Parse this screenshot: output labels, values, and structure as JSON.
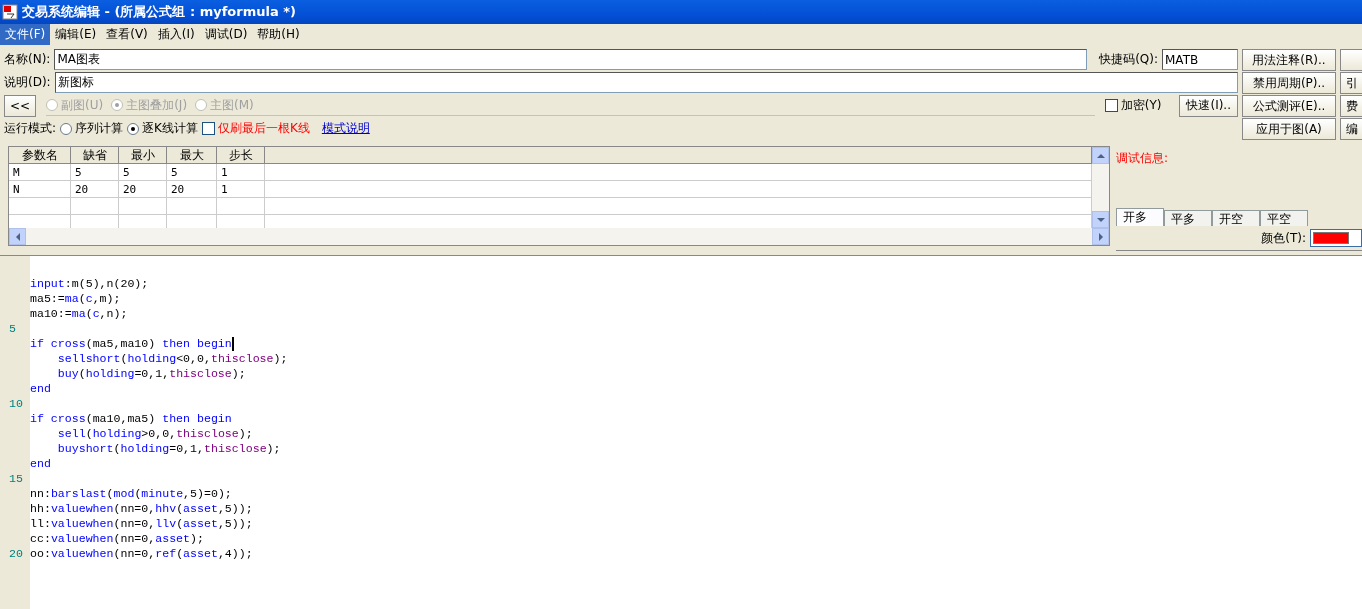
{
  "window": {
    "title": "交易系统编辑 - (所属公式组 : myformula *)"
  },
  "menu": [
    {
      "label": "文件(F)",
      "selected": true
    },
    {
      "label": "编辑(E)",
      "selected": false
    },
    {
      "label": "查看(V)",
      "selected": false
    },
    {
      "label": "插入(I)",
      "selected": false
    },
    {
      "label": "调试(D)",
      "selected": false
    },
    {
      "label": "帮助(H)",
      "selected": false
    }
  ],
  "name_field": {
    "label": "名称(N):",
    "value": "MA图表"
  },
  "shortcut_field": {
    "label": "快捷码(Q):",
    "value": "MATB"
  },
  "desc_field": {
    "label": "说明(D):",
    "value": "新图标"
  },
  "collapse_button": "<<",
  "chart_type": [
    {
      "label": "副图(U)",
      "selected": false,
      "disabled": true
    },
    {
      "label": "主图叠加(J)",
      "selected": true,
      "disabled": true
    },
    {
      "label": "主图(M)",
      "selected": false,
      "disabled": true
    }
  ],
  "encrypt": {
    "label": "加密(Y)",
    "checked": false
  },
  "quick_button": "快速(I)..",
  "run_mode": {
    "label": "运行模式:",
    "options": [
      {
        "label": "序列计算",
        "selected": false
      },
      {
        "label": "逐K线计算",
        "selected": true
      }
    ],
    "refresh_last": {
      "label": "仅刷最后一根K线",
      "checked": false
    },
    "link": "模式说明"
  },
  "buttons": [
    "用法注释(R)..",
    "禁用周期(P)..",
    "公式测评(E)..",
    "应用于图(A)"
  ],
  "cut_buttons": [
    "引",
    "费",
    "编"
  ],
  "table": {
    "columns": [
      "参数名",
      "缺省",
      "最小",
      "最大",
      "步长"
    ],
    "rows": [
      [
        "M",
        "5",
        "5",
        "5",
        "1"
      ],
      [
        "N",
        "20",
        "20",
        "20",
        "1"
      ],
      [
        "",
        "",
        "",
        "",
        ""
      ],
      [
        "",
        "",
        "",
        "",
        ""
      ]
    ]
  },
  "debug": {
    "label": "调试信息:"
  },
  "tabs": [
    {
      "label": "开多",
      "selected": true
    },
    {
      "label": "平多",
      "selected": false
    },
    {
      "label": "开空",
      "selected": false
    },
    {
      "label": "平空",
      "selected": false
    }
  ],
  "color_field": {
    "label": "颜色(T):",
    "color": "#ff0000"
  },
  "code": [
    {
      "tokens": [
        {
          "kind": "kw",
          "text": "input"
        },
        {
          "kind": "plain",
          "text": ":m(5),n(20);"
        }
      ]
    },
    {
      "tokens": [
        {
          "kind": "plain",
          "text": "ma5:="
        },
        {
          "kind": "kw",
          "text": "ma"
        },
        {
          "kind": "plain",
          "text": "("
        },
        {
          "kind": "kw",
          "text": "c"
        },
        {
          "kind": "plain",
          "text": ",m);"
        }
      ]
    },
    {
      "tokens": [
        {
          "kind": "plain",
          "text": "ma10:="
        },
        {
          "kind": "kw",
          "text": "ma"
        },
        {
          "kind": "plain",
          "text": "("
        },
        {
          "kind": "kw",
          "text": "c"
        },
        {
          "kind": "plain",
          "text": ",n);"
        }
      ]
    },
    {
      "number": "5"
    },
    {
      "tokens": [
        {
          "kind": "kw",
          "text": "if cross"
        },
        {
          "kind": "plain",
          "text": "(ma5,ma10) "
        },
        {
          "kind": "kw",
          "text": "then begin"
        }
      ],
      "cursor": true
    },
    {
      "indent": true,
      "tokens": [
        {
          "kind": "kw",
          "text": "sellshort"
        },
        {
          "kind": "plain",
          "text": "("
        },
        {
          "kind": "kw",
          "text": "holding"
        },
        {
          "kind": "plain",
          "text": "<0,0,"
        },
        {
          "kind": "var",
          "text": "thisclose"
        },
        {
          "kind": "plain",
          "text": ");"
        }
      ]
    },
    {
      "indent": true,
      "tokens": [
        {
          "kind": "kw",
          "text": "buy"
        },
        {
          "kind": "plain",
          "text": "("
        },
        {
          "kind": "kw",
          "text": "holding"
        },
        {
          "kind": "plain",
          "text": "=0,1,"
        },
        {
          "kind": "var",
          "text": "thisclose"
        },
        {
          "kind": "plain",
          "text": ");"
        }
      ]
    },
    {
      "tokens": [
        {
          "kind": "kw",
          "text": "end"
        }
      ]
    },
    {
      "number": "10"
    },
    {
      "tokens": [
        {
          "kind": "kw",
          "text": "if cross"
        },
        {
          "kind": "plain",
          "text": "(ma10,ma5) "
        },
        {
          "kind": "kw",
          "text": "then begin"
        }
      ]
    },
    {
      "indent": true,
      "tokens": [
        {
          "kind": "kw",
          "text": "sell"
        },
        {
          "kind": "plain",
          "text": "("
        },
        {
          "kind": "kw",
          "text": "holding"
        },
        {
          "kind": "plain",
          "text": ">0,0,"
        },
        {
          "kind": "var",
          "text": "thisclose"
        },
        {
          "kind": "plain",
          "text": ");"
        }
      ]
    },
    {
      "indent": true,
      "tokens": [
        {
          "kind": "kw",
          "text": "buyshort"
        },
        {
          "kind": "plain",
          "text": "("
        },
        {
          "kind": "kw",
          "text": "holding"
        },
        {
          "kind": "plain",
          "text": "=0,1,"
        },
        {
          "kind": "var",
          "text": "thisclose"
        },
        {
          "kind": "plain",
          "text": ");"
        }
      ]
    },
    {
      "tokens": [
        {
          "kind": "kw",
          "text": "end"
        }
      ]
    },
    {
      "number": "15"
    },
    {
      "tokens": [
        {
          "kind": "plain",
          "text": "nn:"
        },
        {
          "kind": "kw",
          "text": "barslast"
        },
        {
          "kind": "plain",
          "text": "("
        },
        {
          "kind": "kw",
          "text": "mod"
        },
        {
          "kind": "plain",
          "text": "("
        },
        {
          "kind": "kw",
          "text": "minute"
        },
        {
          "kind": "plain",
          "text": ",5)=0);"
        }
      ]
    },
    {
      "tokens": [
        {
          "kind": "plain",
          "text": "hh:"
        },
        {
          "kind": "kw",
          "text": "valuewhen"
        },
        {
          "kind": "plain",
          "text": "(nn=0,"
        },
        {
          "kind": "kw",
          "text": "hhv"
        },
        {
          "kind": "plain",
          "text": "("
        },
        {
          "kind": "kw",
          "text": "asset"
        },
        {
          "kind": "plain",
          "text": ",5));"
        }
      ]
    },
    {
      "tokens": [
        {
          "kind": "plain",
          "text": "ll:"
        },
        {
          "kind": "kw",
          "text": "valuewhen"
        },
        {
          "kind": "plain",
          "text": "(nn=0,"
        },
        {
          "kind": "kw",
          "text": "llv"
        },
        {
          "kind": "plain",
          "text": "("
        },
        {
          "kind": "kw",
          "text": "asset"
        },
        {
          "kind": "plain",
          "text": ",5));"
        }
      ]
    },
    {
      "tokens": [
        {
          "kind": "plain",
          "text": "cc:"
        },
        {
          "kind": "kw",
          "text": "valuewhen"
        },
        {
          "kind": "plain",
          "text": "(nn=0,"
        },
        {
          "kind": "kw",
          "text": "asset"
        },
        {
          "kind": "plain",
          "text": ");"
        }
      ]
    },
    {
      "number": "20",
      "tokens": [
        {
          "kind": "plain",
          "text": "oo:"
        },
        {
          "kind": "kw",
          "text": "valuewhen"
        },
        {
          "kind": "plain",
          "text": "(nn=0,"
        },
        {
          "kind": "kw",
          "text": "ref"
        },
        {
          "kind": "plain",
          "text": "("
        },
        {
          "kind": "kw",
          "text": "asset"
        },
        {
          "kind": "plain",
          "text": ",4));"
        }
      ]
    }
  ]
}
